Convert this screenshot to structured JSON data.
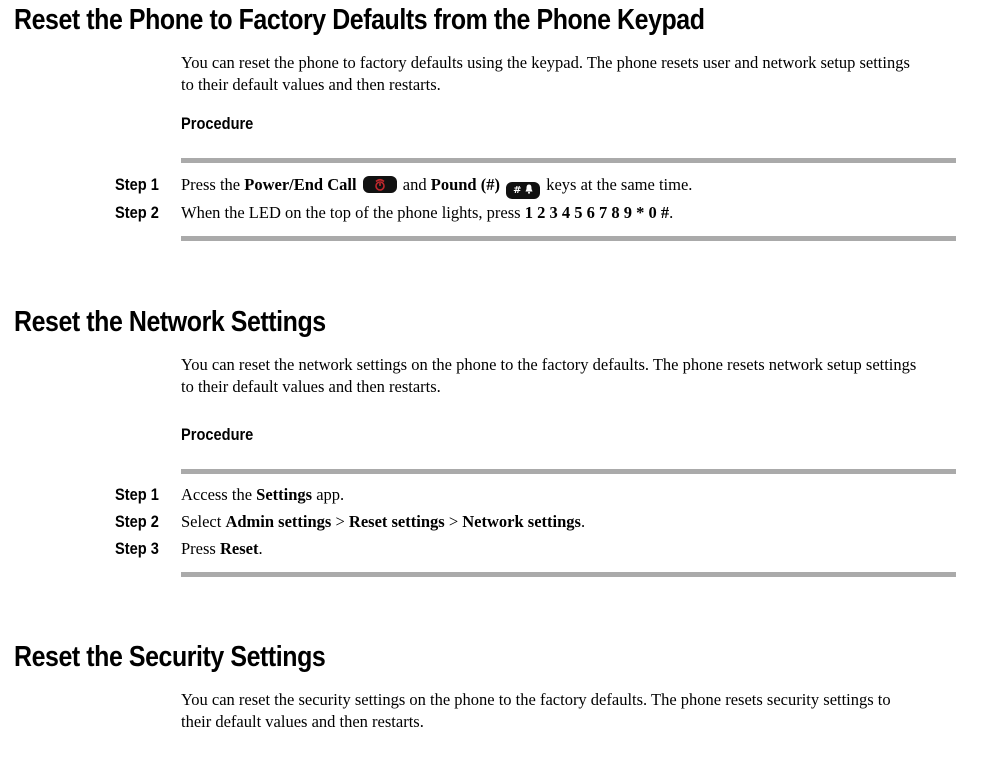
{
  "sections": [
    {
      "title": "Reset the Phone to Factory Defaults from the Phone Keypad",
      "intro_line1": "You can reset the phone to factory defaults using the keypad. The phone resets user and network setup settings",
      "intro_line2": "to their default values and then restarts.",
      "procedure_label": "Procedure",
      "steps": [
        {
          "label": "Step 1",
          "parts": {
            "t1": "Press the ",
            "b1": "Power/End Call",
            "icon1": "power-end-call-key-icon",
            "t2": " and ",
            "b2": "Pound (#)",
            "icon2": "pound-key-icon",
            "icon2_text": "# 🔔",
            "t3": " keys at the same time."
          }
        },
        {
          "label": "Step 2",
          "parts": {
            "t1": "When the LED on the top of the phone lights, press ",
            "b1": "1 2 3 4 5 6 7 8 9 * 0 #",
            "t2": "."
          }
        }
      ]
    },
    {
      "title": "Reset the Network Settings",
      "intro_line1": "You can reset the network settings on the phone to the factory defaults. The phone resets network setup settings",
      "intro_line2": "to their default values and then restarts.",
      "procedure_label": "Procedure",
      "steps": [
        {
          "label": "Step 1",
          "parts": {
            "t1": "Access the ",
            "b1": "Settings",
            "t2": " app."
          }
        },
        {
          "label": "Step 2",
          "parts": {
            "t1": "Select ",
            "b1": "Admin settings",
            "t2": " > ",
            "b2": "Reset settings",
            "t3": " > ",
            "b3": "Network settings",
            "t4": "."
          }
        },
        {
          "label": "Step 3",
          "parts": {
            "t1": "Press ",
            "b1": "Reset",
            "t2": "."
          }
        }
      ]
    },
    {
      "title": "Reset the Security Settings",
      "intro_line1": "You can reset the security settings on the phone to the factory defaults. The phone resets security settings to",
      "intro_line2": "their default values and then restarts."
    }
  ],
  "colors": {
    "rule": "#aaaaaa",
    "key_bg": "#111111",
    "end_call_glyph": "#c0282d"
  }
}
